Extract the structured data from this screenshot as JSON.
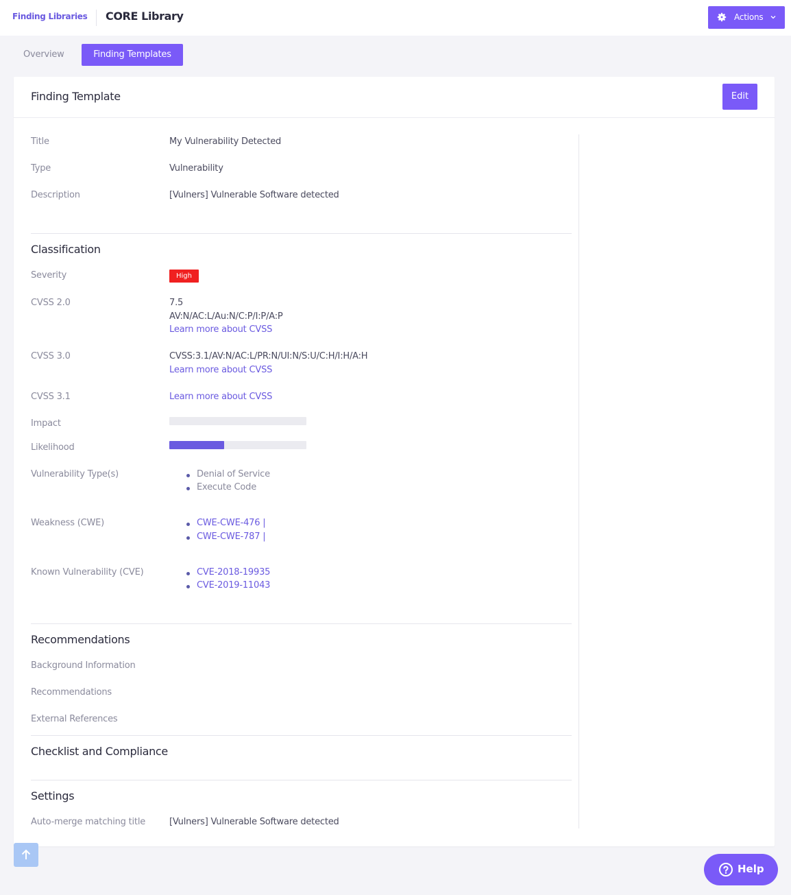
{
  "header": {
    "breadcrumb": "Finding Libraries",
    "title": "CORE Library",
    "actions_label": "Actions"
  },
  "tabs": [
    {
      "label": "Overview",
      "active": false
    },
    {
      "label": "Finding Templates",
      "active": true
    }
  ],
  "card": {
    "title": "Finding Template",
    "edit_label": "Edit"
  },
  "details": {
    "title_label": "Title",
    "title_value": "My Vulnerability Detected",
    "type_label": "Type",
    "type_value": "Vulnerability",
    "description_label": "Description",
    "description_value": "[Vulners] Vulnerable Software detected"
  },
  "classification": {
    "heading": "Classification",
    "severity_label": "Severity",
    "severity_value": "High",
    "severity_color": "#f02020",
    "cvss20_label": "CVSS 2.0",
    "cvss20_score": "7.5",
    "cvss20_vector": "AV:N/AC:L/Au:N/C:P/I:P/A:P",
    "cvss30_label": "CVSS 3.0",
    "cvss30_vector": "CVSS:3.1/AV:N/AC:L/PR:N/UI:N/S:U/C:H/I:H/A:H",
    "cvss31_label": "CVSS 3.1",
    "learn_more": "Learn more about CVSS",
    "impact_label": "Impact",
    "impact_fraction": 0,
    "likelihood_label": "Likelihood",
    "likelihood_fraction": 0.4,
    "vuln_types_label": "Vulnerability Type(s)",
    "vuln_types": [
      "Denial of Service",
      "Execute Code"
    ],
    "cwe_label": "Weakness (CWE)",
    "cwes": [
      "CWE-CWE-476 |",
      "CWE-CWE-787 |"
    ],
    "cve_label": "Known Vulnerability (CVE)",
    "cves": [
      "CVE-2018-19935",
      "CVE-2019-11043"
    ]
  },
  "recommendations": {
    "heading": "Recommendations",
    "background_label": "Background Information",
    "recommendations_label": "Recommendations",
    "external_label": "External References"
  },
  "checklist": {
    "heading": "Checklist and Compliance"
  },
  "settings": {
    "heading": "Settings",
    "automerge_label": "Auto-merge matching title",
    "automerge_value": "[Vulners] Vulnerable Software detected"
  },
  "help": {
    "label": "Help"
  },
  "colors": {
    "accent": "#7a5af8",
    "link": "#6a5ae0"
  }
}
